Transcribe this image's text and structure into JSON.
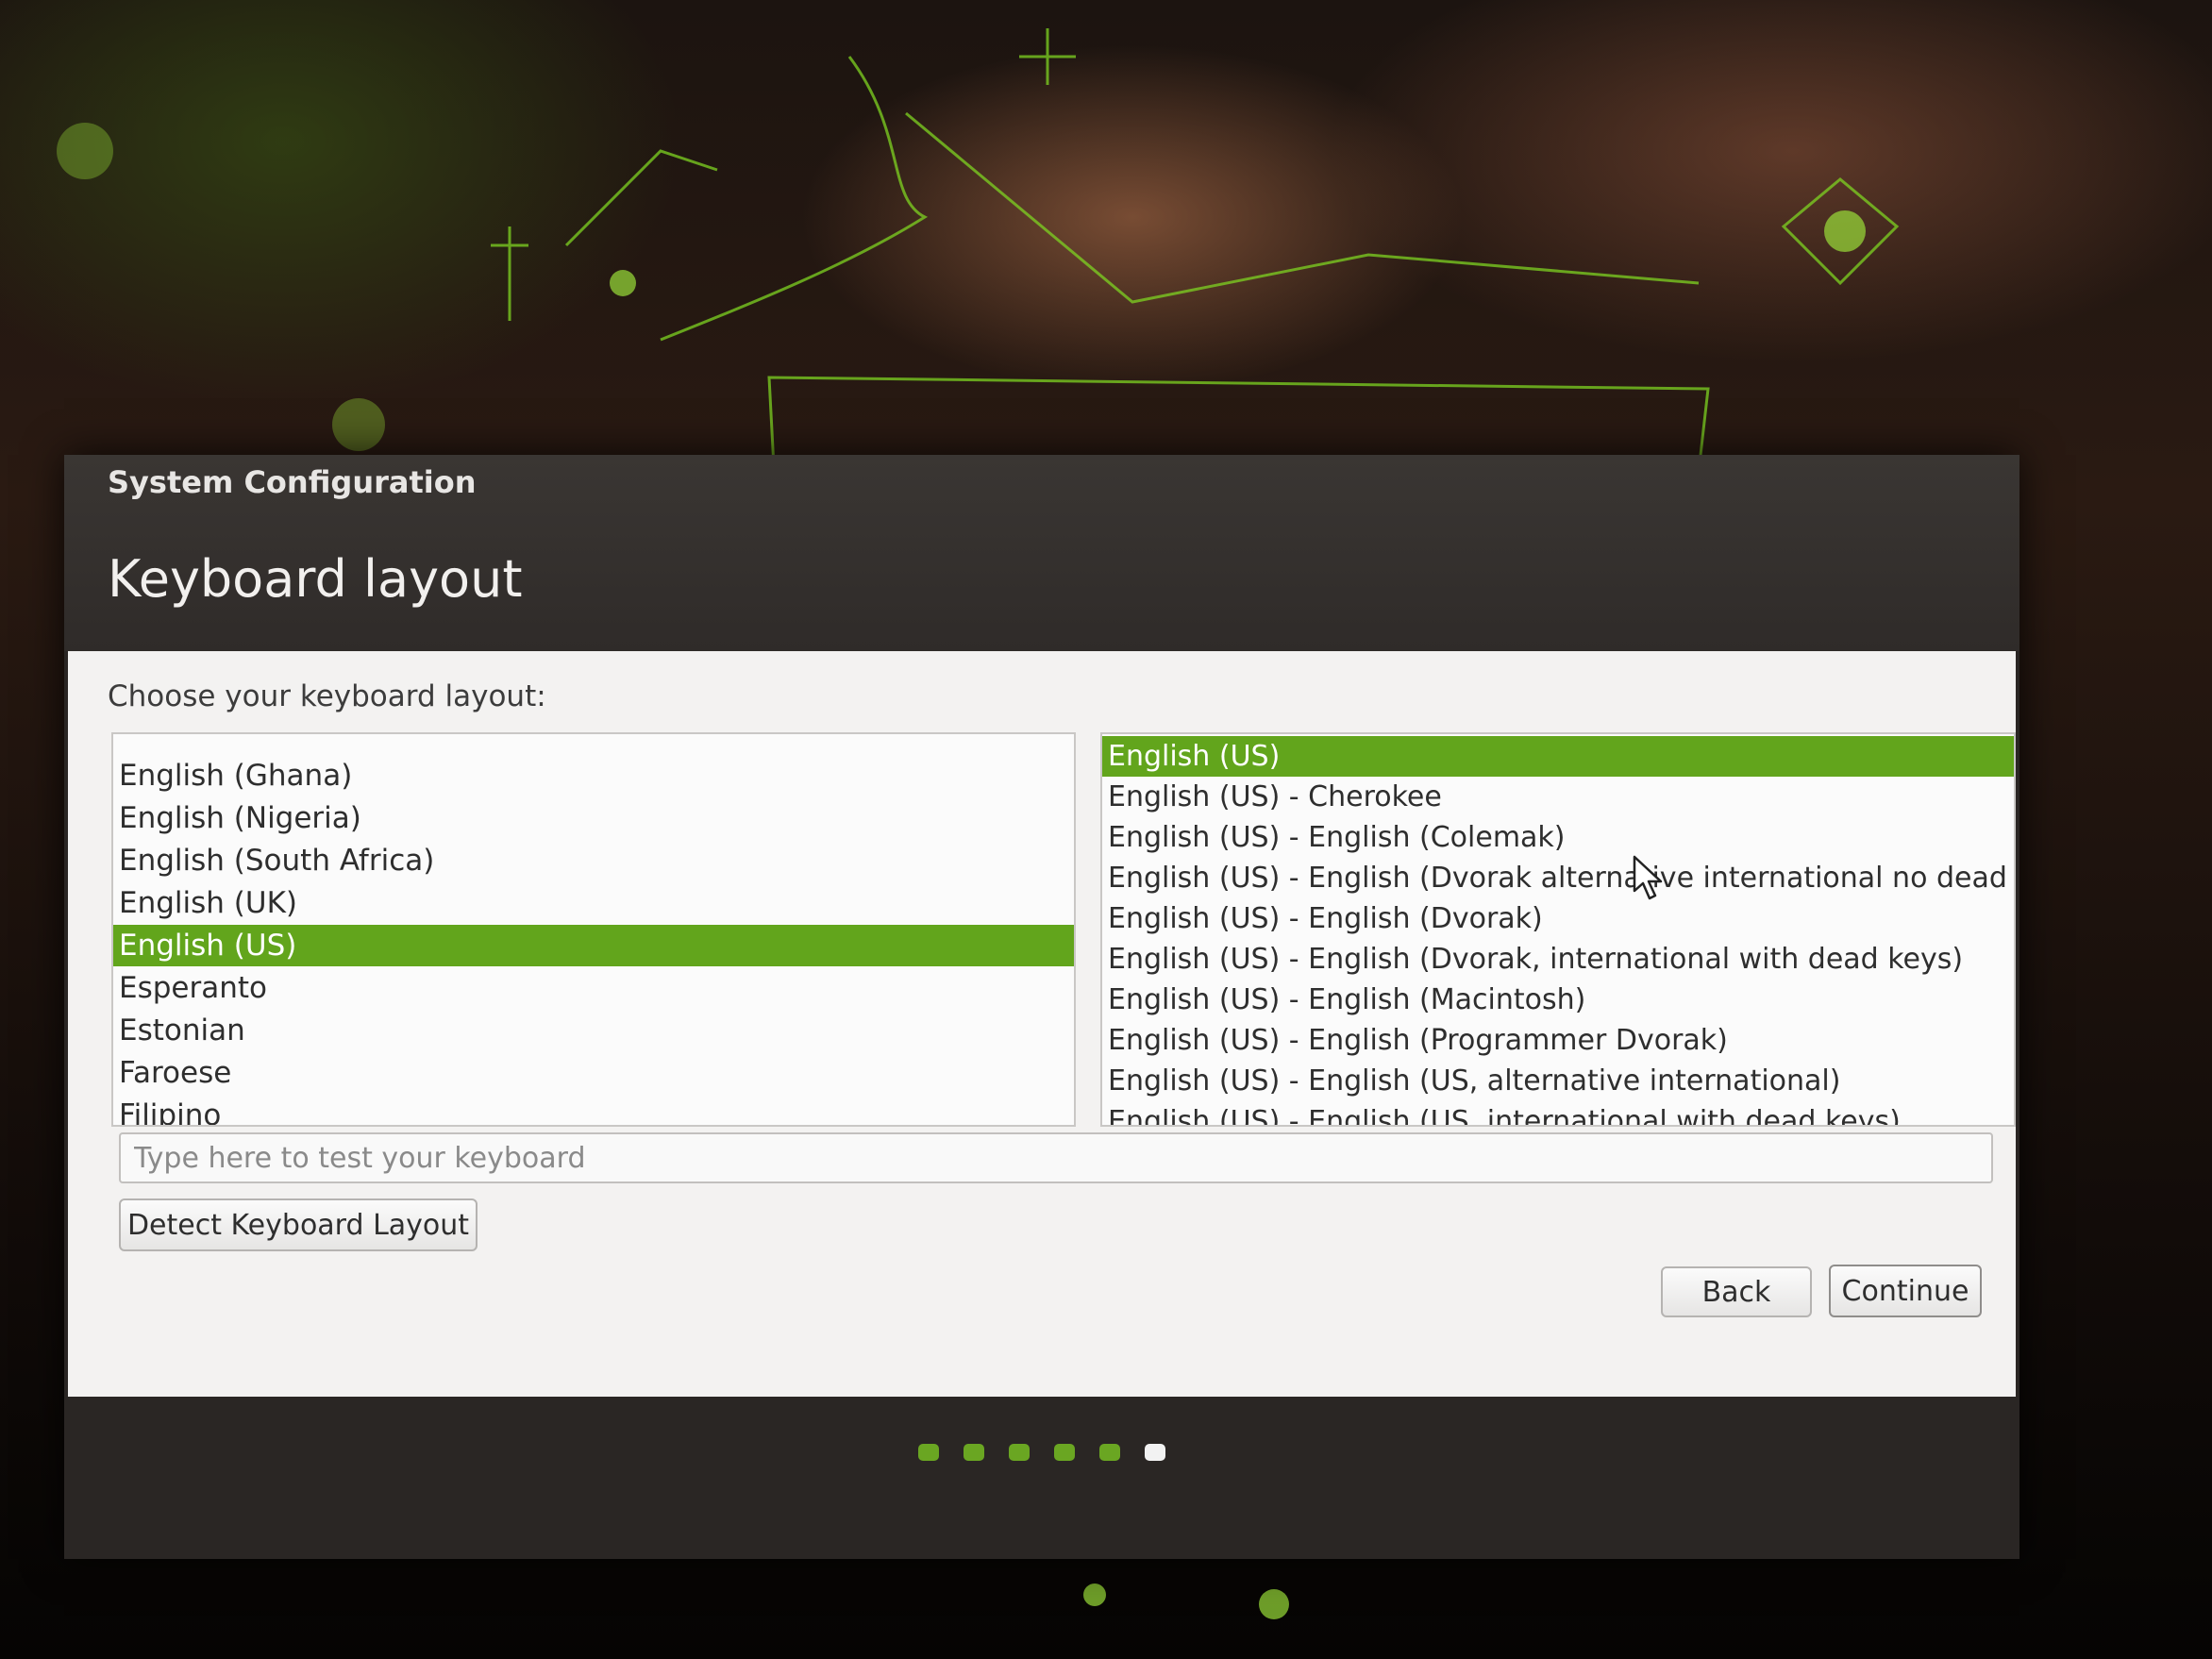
{
  "window": {
    "title": "System Configuration"
  },
  "page": {
    "heading": "Keyboard layout",
    "prompt": "Choose your keyboard layout:"
  },
  "layouts": [
    {
      "label": "English (Ghana)",
      "selected": false
    },
    {
      "label": "English (Nigeria)",
      "selected": false
    },
    {
      "label": "English (South Africa)",
      "selected": false
    },
    {
      "label": "English (UK)",
      "selected": false
    },
    {
      "label": "English (US)",
      "selected": true
    },
    {
      "label": "Esperanto",
      "selected": false
    },
    {
      "label": "Estonian",
      "selected": false
    },
    {
      "label": "Faroese",
      "selected": false
    },
    {
      "label": "Filipino",
      "selected": false
    }
  ],
  "variants": [
    {
      "label": "English (US)",
      "selected": true
    },
    {
      "label": "English (US) - Cherokee",
      "selected": false
    },
    {
      "label": "English (US) - English (Colemak)",
      "selected": false
    },
    {
      "label": "English (US) - English (Dvorak alternative international no dead keys)",
      "selected": false
    },
    {
      "label": "English (US) - English (Dvorak)",
      "selected": false
    },
    {
      "label": "English (US) - English (Dvorak, international with dead keys)",
      "selected": false
    },
    {
      "label": "English (US) - English (Macintosh)",
      "selected": false
    },
    {
      "label": "English (US) - English (Programmer Dvorak)",
      "selected": false
    },
    {
      "label": "English (US) - English (US, alternative international)",
      "selected": false
    },
    {
      "label": "English (US) - English (US, international with dead keys)",
      "selected": false
    }
  ],
  "test_field": {
    "placeholder": "Type here to test your keyboard",
    "value": ""
  },
  "buttons": {
    "detect": "Detect Keyboard Layout",
    "back": "Back",
    "continue": "Continue"
  },
  "progress": {
    "total_steps": 6,
    "current_step": 6
  },
  "colors": {
    "selection": "#62a51c",
    "progress_done": "#6aa622",
    "progress_current": "#f2f2f2"
  }
}
